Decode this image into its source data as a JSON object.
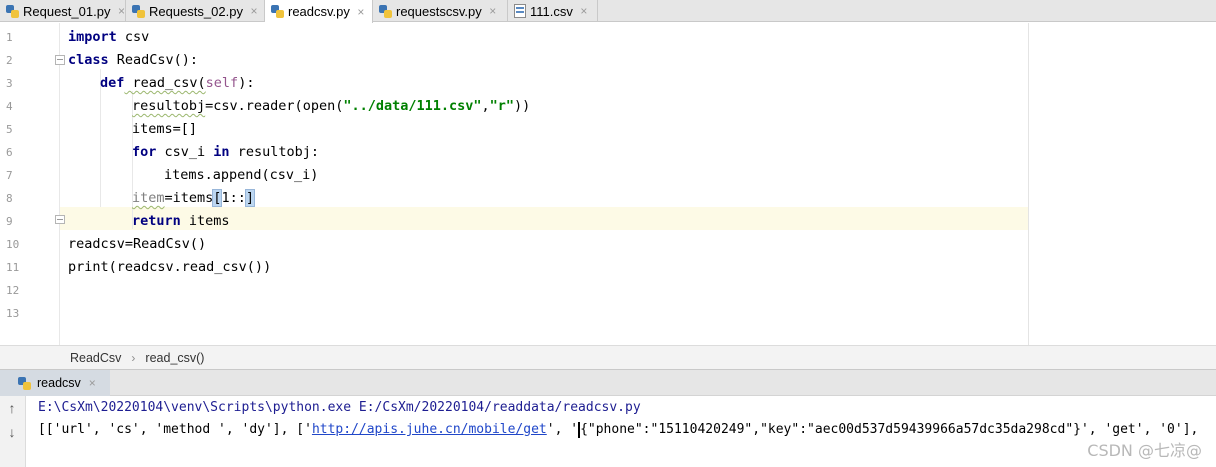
{
  "tabs": [
    {
      "label": "Request_01.py",
      "type": "py",
      "active": false
    },
    {
      "label": "Requests_02.py",
      "type": "py",
      "active": false
    },
    {
      "label": "readcsv.py",
      "type": "py",
      "active": true
    },
    {
      "label": "requestscsv.py",
      "type": "py",
      "active": false
    },
    {
      "label": "111.csv",
      "type": "csv",
      "active": false
    }
  ],
  "editor": {
    "line_numbers": [
      "1",
      "2",
      "3",
      "4",
      "5",
      "6",
      "7",
      "8",
      "9",
      "10",
      "11",
      "12",
      "13"
    ],
    "code": {
      "l1_kw": "import",
      "l1_rest": " csv",
      "l2_kw": "class",
      "l2_rest": " ReadCsv():",
      "l3_kw": "def",
      "l3_fn": " read_csv(",
      "l3_self": "self",
      "l3_end": "):",
      "l4_a": "resultobj",
      "l4_b": "=csv.reader(open(",
      "l4_s1": "\"../data/111.csv\"",
      "l4_c": ",",
      "l4_s2": "\"r\"",
      "l4_d": "))",
      "l5": "items=[]",
      "l6_kw": "for",
      "l6_mid": " csv_i ",
      "l6_kw2": "in",
      "l6_end": " resultobj:",
      "l7": "items.append(csv_i)",
      "l8_a": "item",
      "l8_b": "=items",
      "l8_c": "[",
      "l8_d": "1::",
      "l8_e": "]",
      "l9_kw": "return",
      "l9_rest": " items",
      "l10": "readcsv=ReadCsv()",
      "l11": "print(readcsv.read_csv())"
    }
  },
  "breadcrumb": {
    "class": "ReadCsv",
    "method": "read_csv()",
    "sep": "›"
  },
  "run_panel": {
    "tab_label": "readcsv",
    "command": "E:\\CsXm\\20220104\\venv\\Scripts\\python.exe E:/CsXm/20220104/readdata/readcsv.py",
    "output_prefix": "[['url', 'cs', 'method ', 'dy'], ['",
    "output_link": "http://apis.juhe.cn/mobile/get",
    "output_mid": "', '",
    "output_rest": "{\"phone\":\"15110420249\",\"key\":\"aec00d537d59439966a57dc35da298cd\"}', 'get', '0'],"
  },
  "watermark": "CSDN @七凉@",
  "icons": {
    "close": "×",
    "up": "↑",
    "down": "↓"
  }
}
